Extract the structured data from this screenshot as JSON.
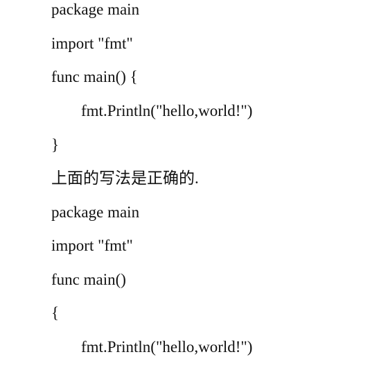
{
  "document": {
    "lines": [
      "package main",
      "import \"fmt\"",
      "func main() {",
      "fmt.Println(\"hello,world!\")",
      "}",
      "上面的写法是正确的.",
      "package main",
      "import \"fmt\"",
      "func main()",
      "{",
      "fmt.Println(\"hello,world!\")"
    ]
  }
}
